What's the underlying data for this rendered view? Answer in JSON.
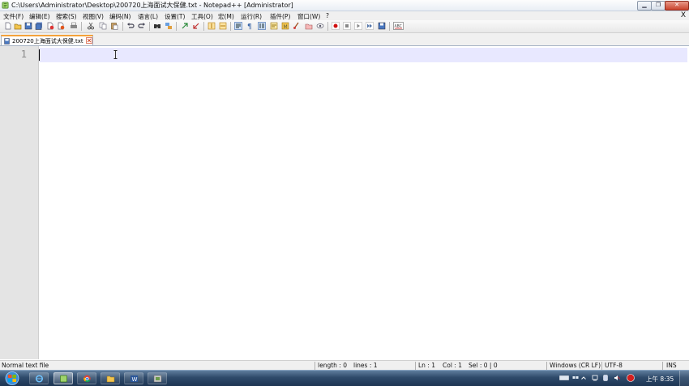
{
  "window": {
    "title": "C:\\Users\\Administrator\\Desktop\\200720上海面试大保健.txt - Notepad++ [Administrator]"
  },
  "menu": {
    "items": [
      "文件(F)",
      "编辑(E)",
      "搜索(S)",
      "视图(V)",
      "编码(N)",
      "语言(L)",
      "设置(T)",
      "工具(O)",
      "宏(M)",
      "运行(R)",
      "插件(P)",
      "窗口(W)",
      "?"
    ],
    "close_glyph": "X"
  },
  "tab": {
    "filename": "200720上海面试大保健.txt"
  },
  "editor": {
    "line_numbers": [
      "1"
    ],
    "content": ""
  },
  "status": {
    "file_type": "Normal text file",
    "length": "length : 0",
    "lines": "lines : 1",
    "ln": "Ln : 1",
    "col": "Col : 1",
    "sel": "Sel : 0 | 0",
    "eol": "Windows (CR LF)",
    "encoding": "UTF-8",
    "mode": "INS"
  },
  "taskbar": {
    "clock": "上午 8:35"
  },
  "colors": {
    "tab_accent": "#f4a23a",
    "current_line": "#e8e8ff",
    "gutter": "#e4e4e4"
  }
}
